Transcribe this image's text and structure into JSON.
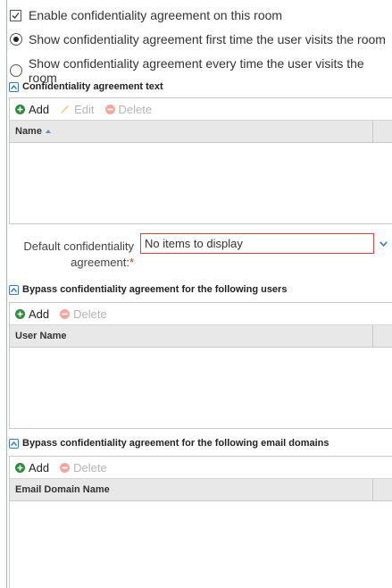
{
  "options": {
    "enable_label": "Enable confidentiality agreement on this room",
    "enable_checked": true,
    "radio_first_label": "Show confidentiality agreement first time the user visits the room",
    "radio_every_label": "Show confidentiality agreement every time the user visits the room",
    "selected_radio": "first"
  },
  "agreement_section": {
    "title": "Confidentiality agreement text",
    "toolbar": {
      "add": "Add",
      "edit": "Edit",
      "delete": "Delete"
    },
    "column": "Name"
  },
  "default_agreement": {
    "label_line1": "Default confidentiality",
    "label_line2": "agreement:",
    "required_mark": "*",
    "value": "No items to display"
  },
  "bypass_users": {
    "title": "Bypass confidentiality agreement for the following users",
    "toolbar": {
      "add": "Add",
      "delete": "Delete"
    },
    "column": "User Name"
  },
  "bypass_domains": {
    "title": "Bypass confidentiality agreement for the following email domains",
    "toolbar": {
      "add": "Add",
      "delete": "Delete"
    },
    "column": "Email Domain Name"
  },
  "colors": {
    "add_icon": "#2e8b3a",
    "delete_icon_disabled": "#f4a7a0",
    "edit_icon_disabled": "#f1c27d",
    "error_border": "#e0433a",
    "section_icon": "#3a79b8"
  }
}
